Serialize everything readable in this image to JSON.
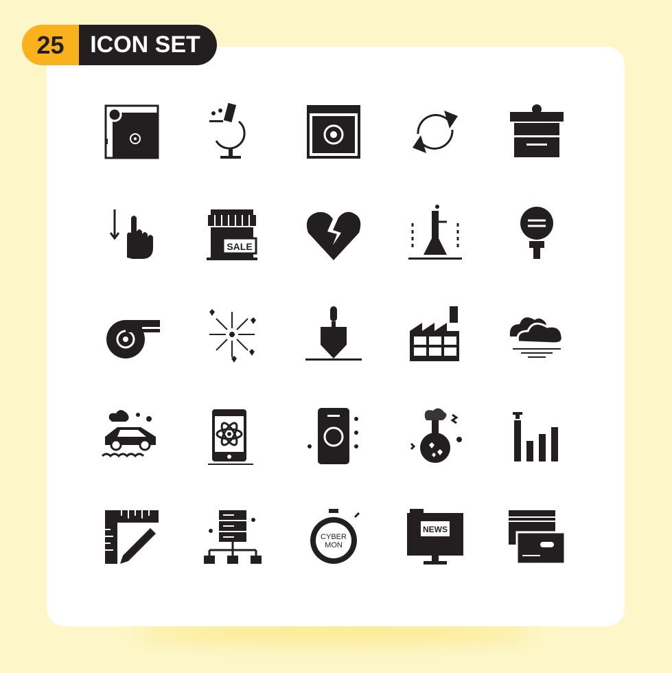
{
  "badge": {
    "count": "25",
    "title": "ICON SET",
    "accent_color": "#f9b21d",
    "dark_color": "#231f20"
  },
  "background_color": "#fdf6c8",
  "icons": [
    {
      "name": "billiard-table-icon"
    },
    {
      "name": "microscope-icon"
    },
    {
      "name": "browser-settings-icon"
    },
    {
      "name": "refresh-arrows-icon"
    },
    {
      "name": "gift-box-icon"
    },
    {
      "name": "swipe-down-hand-icon"
    },
    {
      "name": "shop-sale-icon",
      "text": "SALE"
    },
    {
      "name": "broken-heart-icon"
    },
    {
      "name": "lab-flask-icon"
    },
    {
      "name": "idea-bulb-icon"
    },
    {
      "name": "whistle-icon"
    },
    {
      "name": "fireworks-icon"
    },
    {
      "name": "trowel-icon"
    },
    {
      "name": "factory-icon"
    },
    {
      "name": "clouds-sea-icon"
    },
    {
      "name": "car-flood-icon"
    },
    {
      "name": "mobile-atom-icon"
    },
    {
      "name": "smartphone-icon"
    },
    {
      "name": "chemistry-flask-icon"
    },
    {
      "name": "signal-bars-icon"
    },
    {
      "name": "ruler-pencil-icon"
    },
    {
      "name": "server-network-icon"
    },
    {
      "name": "cyber-monday-stopwatch-icon",
      "text": "CYBER MON"
    },
    {
      "name": "news-monitor-icon",
      "text": "NEWS"
    },
    {
      "name": "credit-cards-icon"
    }
  ]
}
